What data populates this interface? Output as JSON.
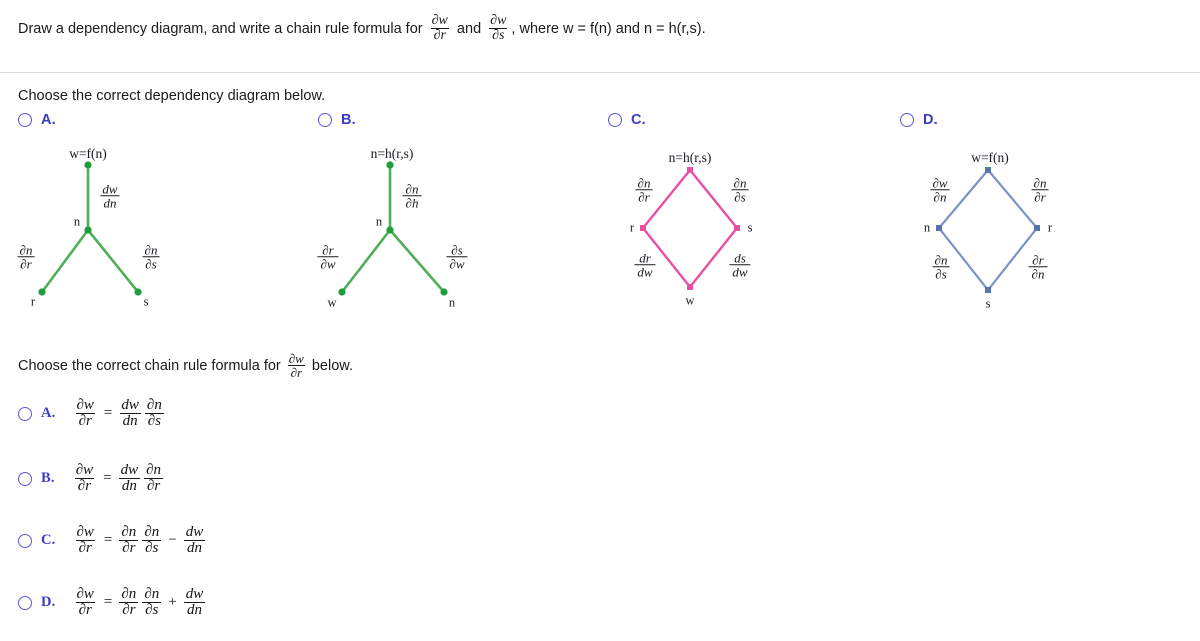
{
  "header": {
    "text_before": "Draw a dependency diagram, and write a chain rule formula for ",
    "frac1": {
      "num": "∂w",
      "den": "∂r"
    },
    "text_mid": " and ",
    "frac2": {
      "num": "∂w",
      "den": "∂s"
    },
    "text_after": ", where w = f(n) and n = h(r,s)."
  },
  "prompt_diagram": "Choose the correct dependency diagram below.",
  "prompt_formula": {
    "before": "Choose the correct chain rule formula for ",
    "frac": {
      "num": "∂w",
      "den": "∂r"
    },
    "after": " below."
  },
  "diagram_options": [
    {
      "letter": "A.",
      "type": "tree",
      "color": "#4fae5a",
      "top_label": "w=f(n)",
      "mid_label": "n",
      "stem_label": {
        "num": "dw",
        "den": "dn"
      },
      "left_label": {
        "num": "∂n",
        "den": "∂r"
      },
      "right_label": {
        "num": "∂n",
        "den": "∂s"
      },
      "bottom_left": "r",
      "bottom_right": "s"
    },
    {
      "letter": "B.",
      "type": "tree",
      "color": "#4fae5a",
      "top_label": "n=h(r,s)",
      "mid_label": "n",
      "stem_label": {
        "num": "∂n",
        "den": "∂h"
      },
      "left_label": {
        "num": "∂r",
        "den": "∂w"
      },
      "right_label": {
        "num": "∂s",
        "den": "∂w"
      },
      "bottom_left": "w",
      "bottom_right": "n"
    },
    {
      "letter": "C.",
      "type": "diamond",
      "color": "#e8519f",
      "top_label": "n=h(r,s)",
      "left_node": "r",
      "right_node": "s",
      "bottom_node": "w",
      "upper_left": {
        "num": "∂n",
        "den": "∂r"
      },
      "upper_right": {
        "num": "∂n",
        "den": "∂s"
      },
      "lower_left": {
        "num": "dr",
        "den": "dw"
      },
      "lower_right": {
        "num": "ds",
        "den": "dw"
      }
    },
    {
      "letter": "D.",
      "type": "diamond",
      "color": "#7a93c4",
      "top_label": "w=f(n)",
      "left_node": "n",
      "right_node": "r",
      "bottom_node": "s",
      "upper_left": {
        "num": "∂w",
        "den": "∂n"
      },
      "upper_right": {
        "num": "∂n",
        "den": "∂r"
      },
      "lower_left": {
        "num": "∂n",
        "den": "∂s"
      },
      "lower_right": {
        "num": "∂r",
        "den": "∂n"
      }
    }
  ],
  "formula_options": [
    {
      "letter": "A.",
      "lhs": {
        "num": "∂w",
        "den": "∂r"
      },
      "eq": "=",
      "terms": [
        {
          "num": "dw",
          "den": "dn"
        },
        {
          "num": "∂n",
          "den": "∂s"
        }
      ],
      "op": "",
      "extra": null
    },
    {
      "letter": "B.",
      "lhs": {
        "num": "∂w",
        "den": "∂r"
      },
      "eq": "=",
      "terms": [
        {
          "num": "dw",
          "den": "dn"
        },
        {
          "num": "∂n",
          "den": "∂r"
        }
      ],
      "op": "",
      "extra": null
    },
    {
      "letter": "C.",
      "lhs": {
        "num": "∂w",
        "den": "∂r"
      },
      "eq": "=",
      "terms": [
        {
          "num": "∂n",
          "den": "∂r"
        },
        {
          "num": "∂n",
          "den": "∂s"
        }
      ],
      "op": "−",
      "extra": {
        "num": "dw",
        "den": "dn"
      }
    },
    {
      "letter": "D.",
      "lhs": {
        "num": "∂w",
        "den": "∂r"
      },
      "eq": "=",
      "terms": [
        {
          "num": "∂n",
          "den": "∂r"
        },
        {
          "num": "∂n",
          "den": "∂s"
        }
      ],
      "op": "+",
      "extra": {
        "num": "dw",
        "den": "dn"
      }
    }
  ]
}
